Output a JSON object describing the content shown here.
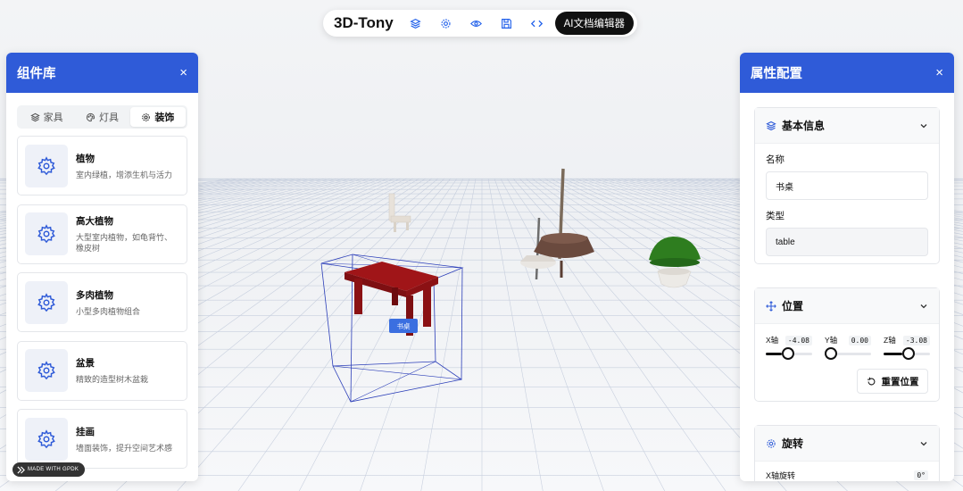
{
  "toolbar": {
    "title": "3D-Tony",
    "icons": [
      "layers-icon",
      "settings-icon",
      "eye-icon",
      "save-icon",
      "code-icon"
    ],
    "ai_button": "AI文档编辑器"
  },
  "left_panel": {
    "title": "组件库",
    "close": "×",
    "tabs": [
      {
        "label": "家具",
        "icon": "layers-icon",
        "active": false
      },
      {
        "label": "灯具",
        "icon": "palette-icon",
        "active": false
      },
      {
        "label": "装饰",
        "icon": "gear-icon",
        "active": true
      }
    ],
    "items": [
      {
        "title": "植物",
        "desc": "室内绿植，增添生机与活力"
      },
      {
        "title": "高大植物",
        "desc": "大型室内植物，如龟背竹、橡皮树"
      },
      {
        "title": "多肉植物",
        "desc": "小型多肉植物组合"
      },
      {
        "title": "盆景",
        "desc": "精致的造型树木盆栽"
      },
      {
        "title": "挂画",
        "desc": "墙面装饰，提升空间艺术感"
      }
    ],
    "badge": "MADE WITH GPDK"
  },
  "scene": {
    "selected_label": "书桌"
  },
  "right_panel": {
    "title": "属性配置",
    "close": "×",
    "basic": {
      "title": "基本信息",
      "name_label": "名称",
      "name_value": "书桌",
      "type_label": "类型",
      "type_value": "table"
    },
    "position": {
      "title": "位置",
      "axes": [
        {
          "label": "X轴",
          "value": "-4.08",
          "fraction": 0.35
        },
        {
          "label": "Y轴",
          "value": "0.00",
          "fraction": 0.0
        },
        {
          "label": "Z轴",
          "value": "-3.08",
          "fraction": 0.4
        }
      ],
      "reset": "重置位置"
    },
    "rotation": {
      "title": "旋转",
      "x_label": "X轴旋转",
      "x_value": "0°"
    }
  },
  "colors": {
    "accent": "#2f5bd8",
    "table_red": "#9b1215",
    "plant_green": "#2e7d1f"
  }
}
